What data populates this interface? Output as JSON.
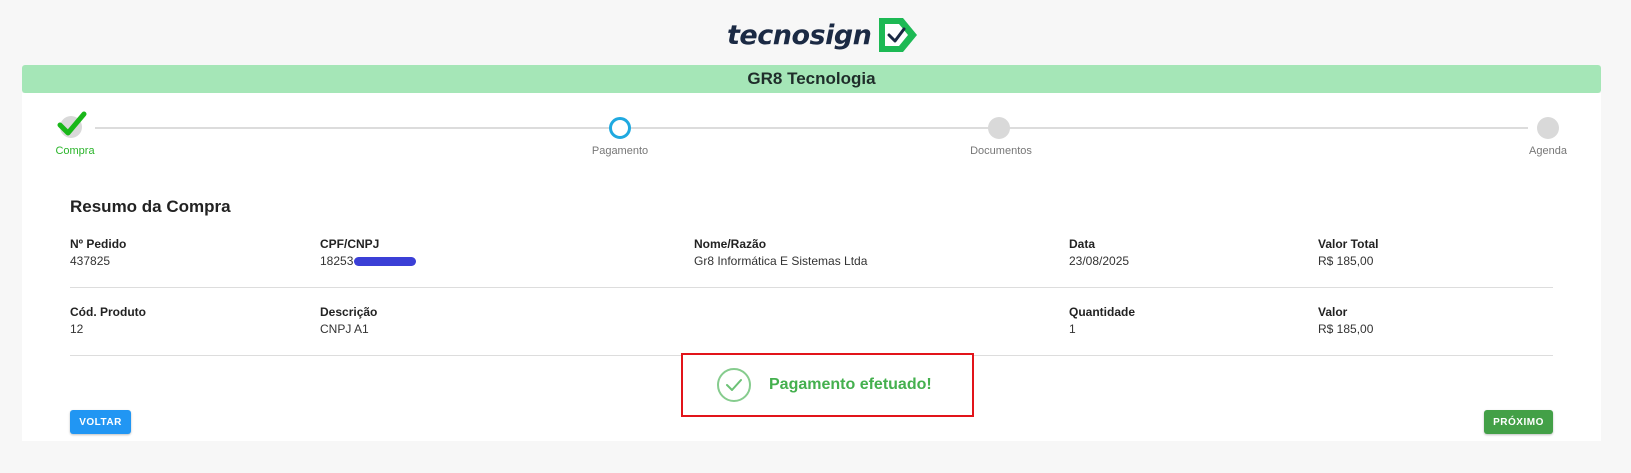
{
  "brand": {
    "name": "tecnosign",
    "accent": "#1db954"
  },
  "company": {
    "name": "GR8 Tecnologia"
  },
  "stepper": {
    "steps": [
      {
        "label": "Compra",
        "status": "completed"
      },
      {
        "label": "Pagamento",
        "status": "active"
      },
      {
        "label": "Documentos",
        "status": "pending"
      },
      {
        "label": "Agenda",
        "status": "pending"
      }
    ]
  },
  "summary": {
    "title": "Resumo da Compra",
    "order": {
      "order_number_label": "Nº Pedido",
      "order_number": "437825",
      "document_label": "CPF/CNPJ",
      "document_visible": "18253",
      "name_label": "Nome/Razão",
      "name": "Gr8 Informática E Sistemas Ltda",
      "date_label": "Data",
      "date": "23/08/2025",
      "total_label": "Valor Total",
      "total": "R$ 185,00"
    },
    "product": {
      "code_label": "Cód. Produto",
      "code": "12",
      "description_label": "Descrição",
      "description": "CNPJ A1",
      "quantity_label": "Quantidade",
      "quantity": "1",
      "value_label": "Valor",
      "value": "R$ 185,00"
    }
  },
  "alert": {
    "message": "Pagamento efetuado!",
    "icon": "check-circle-icon"
  },
  "buttons": {
    "back": "VOLTAR",
    "next": "PRÓXIMO"
  },
  "colors": {
    "company_bar": "#a5e6b7",
    "step_active": "#1fa9e0",
    "step_done": "#2bb52b",
    "btn_back": "#2196f3",
    "btn_next": "#43a047",
    "alert_border": "#e2141a",
    "alert_text": "#44b04e"
  }
}
